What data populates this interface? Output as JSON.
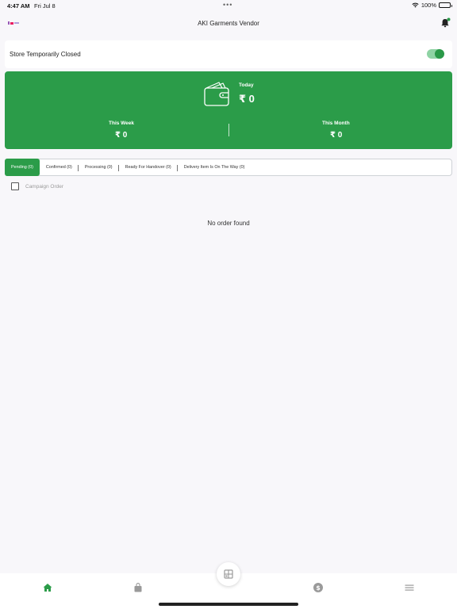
{
  "status_bar": {
    "time": "4:47 AM",
    "date": "Fri Jul 8",
    "battery": "100%"
  },
  "header": {
    "title": "AKI Garments Vendor"
  },
  "store": {
    "label": "Store Temporarily Closed",
    "toggle_on": true
  },
  "earnings": {
    "today_label": "Today",
    "today_value": "₹ 0",
    "week_label": "This Week",
    "week_value": "₹ 0",
    "month_label": "This Month",
    "month_value": "₹ 0"
  },
  "tabs": [
    {
      "label": "Pending (0)",
      "active": true
    },
    {
      "label": "Confirmed (0)"
    },
    {
      "label": "Processing (0)"
    },
    {
      "label": "Ready For Handover (0)"
    },
    {
      "label": "Delivery Item Is On The Way (0)"
    }
  ],
  "campaign": {
    "label": "Campaign Order",
    "checked": false
  },
  "empty_message": "No order found",
  "nav": {
    "items": [
      "home-icon",
      "shopping-bag-icon",
      "pos-icon",
      "dollar-icon",
      "menu-icon"
    ]
  },
  "colors": {
    "primary": "#2b9c49",
    "nav_inactive": "#9a9a9a"
  }
}
